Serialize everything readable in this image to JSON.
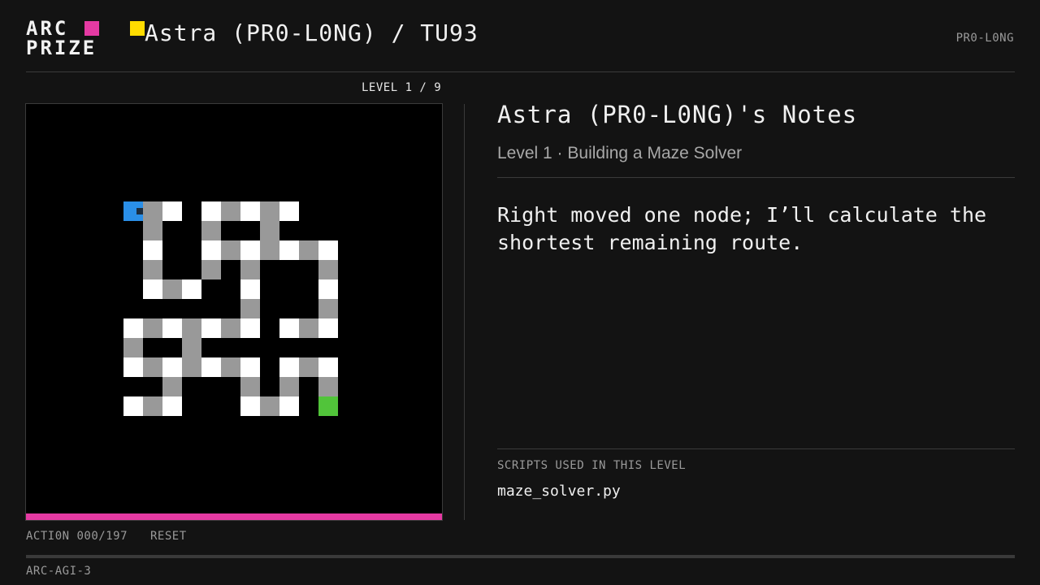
{
  "header": {
    "logo_line1": "ARC",
    "logo_line2": "PRIZE",
    "title": "Astra (PR0-L0NG) / TU93",
    "mode_badge": "PR0-L0NG"
  },
  "game": {
    "level_indicator": "LEVEL 1 / 9",
    "action_counter": "ACTI0N 000/197",
    "reset_label": "RESET",
    "progress_fraction": 1.0,
    "colors": {
      "background": "#000000",
      "white": "#ffffff",
      "gray": "#999999",
      "agent": "#2a8fe8",
      "goal": "#51c43a",
      "progress": "#e53aa3"
    },
    "grid": [
      "                     ",
      "                     ",
      "                     ",
      "                     ",
      "                     ",
      "     AGW WGWGW       ",
      "      G  G  G        ",
      "      W  WGWGWGW     ",
      "      G  G G   G     ",
      "      WGW  W   W     ",
      "           G   G     ",
      "     WGWGWGW WGW     ",
      "     G  G            ",
      "     WGWGWGW WGW     ",
      "       G   G G G     ",
      "     WGW   WGW E     ",
      "                     ",
      "                     ",
      "                     ",
      "                     ",
      "                     "
    ]
  },
  "notes": {
    "title": "Astra (PR0-L0NG)'s Notes",
    "subtitle": "Level 1 · Building a Maze Solver",
    "body": "Right moved one node; I’ll calculate the shortest remaining route.",
    "scripts_heading": "SCRIPTS USED IN THIS LEVEL",
    "scripts": [
      "maze_solver.py"
    ]
  },
  "footer": {
    "label": "ARC-AGI-3"
  }
}
